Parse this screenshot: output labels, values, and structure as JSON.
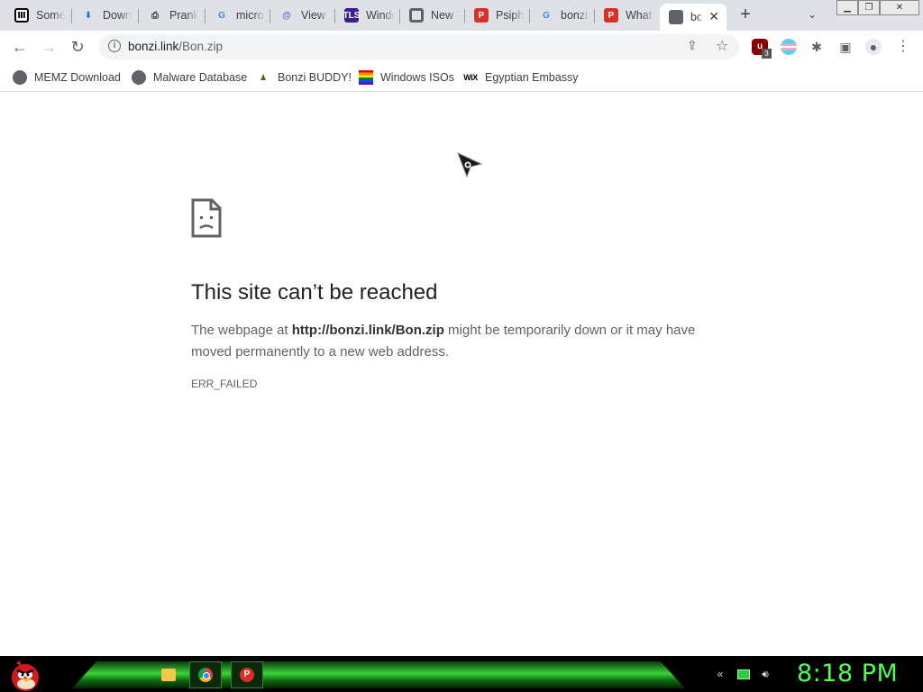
{
  "tabs": [
    {
      "title": "Some",
      "icon": "library-icon",
      "glyph": "Ⅲ"
    },
    {
      "title": "Down",
      "icon": "download-icon",
      "glyph": "⬇"
    },
    {
      "title": "Prank",
      "icon": "printer-icon",
      "glyph": "⎙"
    },
    {
      "title": "micro",
      "icon": "google-icon",
      "glyph": "G"
    },
    {
      "title": "View",
      "icon": "at-sign-icon",
      "glyph": "@"
    },
    {
      "title": "Windo",
      "icon": "tls-icon",
      "glyph": "TLS"
    },
    {
      "title": "New T",
      "icon": "chrome-icon",
      "glyph": ""
    },
    {
      "title": "Psiph",
      "icon": "psiphon-icon",
      "glyph": "P"
    },
    {
      "title": "bonzi",
      "icon": "google-icon",
      "glyph": "G"
    },
    {
      "title": "What",
      "icon": "psiphon-icon",
      "glyph": "P"
    },
    {
      "title": "bc",
      "icon": "globe-icon",
      "glyph": "",
      "active": true
    }
  ],
  "toolbar": {
    "url_host": "bonzi.link",
    "url_path": "/Bon.zip",
    "ublock_badge": "3"
  },
  "bookmarks": [
    {
      "label": "MEMZ Download",
      "icon": "globe-icon"
    },
    {
      "label": "Malware Database",
      "icon": "globe-icon"
    },
    {
      "label": "Bonzi BUDDY!",
      "icon": "bonzi-icon"
    },
    {
      "label": "Windows ISOs",
      "icon": "rainbow-flag-icon"
    },
    {
      "label": "Egyptian Embassy",
      "icon": "wix-icon",
      "glyph": "WiX"
    }
  ],
  "error": {
    "title": "This site can’t be reached",
    "msg_prefix": "The webpage at ",
    "msg_url": "http://bonzi.link/Bon.zip",
    "msg_suffix": " might be temporarily down or it may have moved permanently to a new web address.",
    "code": "ERR_FAILED"
  },
  "taskbar": {
    "clock": "8:18 PM"
  }
}
